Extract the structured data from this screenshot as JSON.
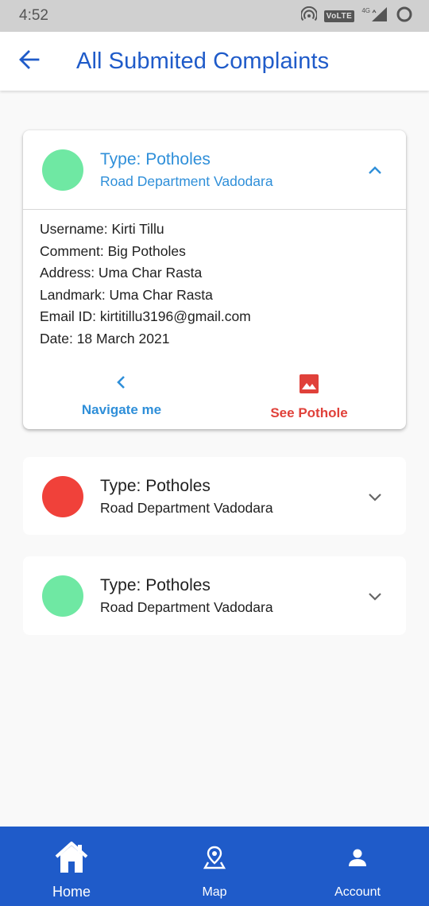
{
  "status_bar": {
    "time": "4:52",
    "volte": "VoLTE",
    "network": "4G",
    "icons": [
      "hotspot-icon",
      "volte-icon",
      "signal-icon",
      "loading-icon"
    ]
  },
  "app_bar": {
    "back_icon": "arrow-left-icon",
    "title": "All Submited Complaints"
  },
  "colors": {
    "primary": "#1f5bc9",
    "accent_blue": "#2f8fd9",
    "accent_red": "#e0413a",
    "status_green": "#6fe8a3",
    "status_red": "#f0413a"
  },
  "complaints": [
    {
      "type": "Type: Potholes",
      "department": "Road Department Vadodara",
      "status_color": "#6fe8a3",
      "expanded": true,
      "details": {
        "username": "Username: Kirti Tillu",
        "comment": "Comment: Big Potholes",
        "address": "Address: Uma Char Rasta",
        "landmark": "Landmark: Uma Char Rasta",
        "email": "Email ID: kirtitillu3196@gmail.com",
        "date": "Date: 18 March 2021"
      },
      "actions": {
        "navigate_label": "Navigate me",
        "navigate_icon": "chevron-left-icon",
        "see_label": "See Pothole",
        "see_icon": "image-icon"
      }
    },
    {
      "type": "Type: Potholes",
      "department": "Road Department Vadodara",
      "status_color": "#f0413a",
      "expanded": false
    },
    {
      "type": "Type: Potholes",
      "department": "Road Department Vadodara",
      "status_color": "#6fe8a3",
      "expanded": false
    }
  ],
  "bottom_nav": {
    "items": [
      {
        "label": "Home",
        "icon": "home-icon"
      },
      {
        "label": "Map",
        "icon": "map-pin-icon"
      },
      {
        "label": "Account",
        "icon": "account-icon"
      }
    ]
  }
}
